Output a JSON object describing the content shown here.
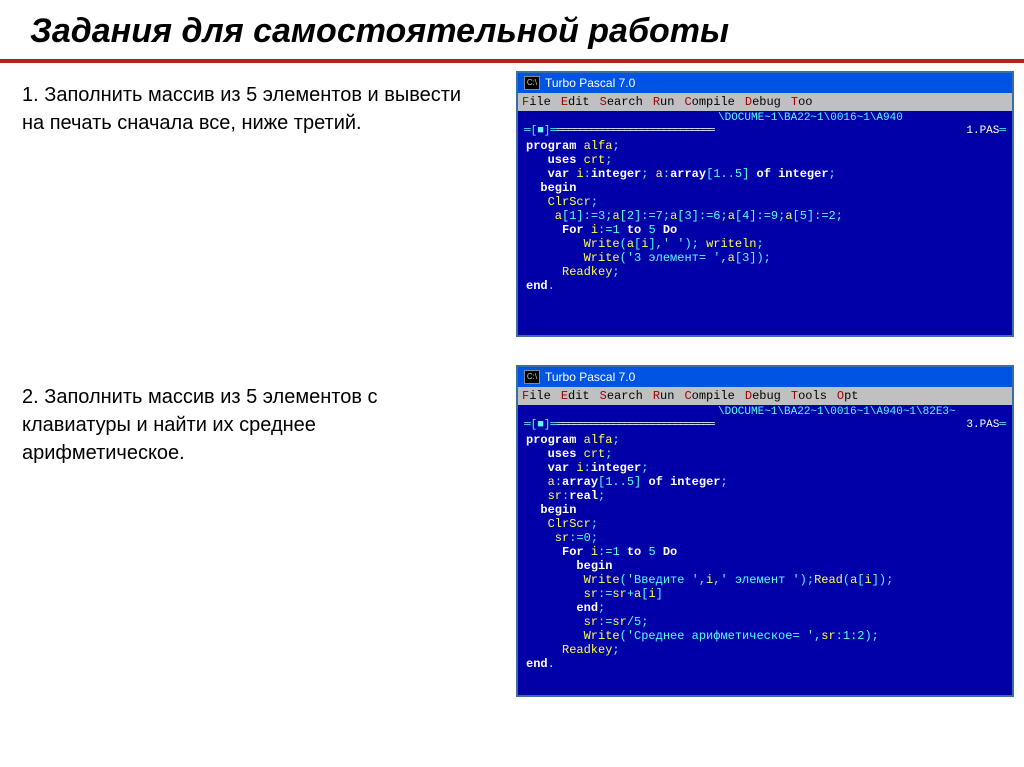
{
  "title": "Задания для самостоятельной работы",
  "task1": "1. Заполнить массив из 5 элементов и вывести на печать сначала все, ниже третий.",
  "task2": "2. Заполнить массив из 5 элементов с клавиатуры и найти их среднее арифметическое.",
  "windows": [
    {
      "titlebar_icon": "C:\\",
      "titlebar_text": "Turbo Pascal 7.0",
      "menu": [
        "File",
        "Edit",
        "Search",
        "Run",
        "Compile",
        "Debug",
        "Too"
      ],
      "path": "\\DOCUME~1\\BA22~1\\0016~1\\A940",
      "file_tab": "1.PAS",
      "code_lines": [
        [
          [
            "kw",
            "program"
          ],
          [
            "id",
            " alfa"
          ],
          [
            "sym",
            ";"
          ]
        ],
        [
          [
            "id",
            "   "
          ],
          [
            "kw",
            "uses"
          ],
          [
            "id",
            " crt"
          ],
          [
            "sym",
            ";"
          ]
        ],
        [
          [
            "id",
            "   "
          ],
          [
            "kw",
            "var"
          ],
          [
            "id",
            " i"
          ],
          [
            "sym",
            ":"
          ],
          [
            "kw",
            "integer"
          ],
          [
            "sym",
            "; "
          ],
          [
            "id",
            "a"
          ],
          [
            "sym",
            ":"
          ],
          [
            "kw",
            "array"
          ],
          [
            "sym",
            "["
          ],
          [
            "num",
            "1..5"
          ],
          [
            "sym",
            "] "
          ],
          [
            "kw",
            "of"
          ],
          [
            "id",
            " "
          ],
          [
            "kw",
            "integer"
          ],
          [
            "sym",
            ";"
          ]
        ],
        [
          [
            "id",
            "  "
          ],
          [
            "kw",
            "begin"
          ]
        ],
        [
          [
            "id",
            "   ClrScr"
          ],
          [
            "sym",
            ";"
          ]
        ],
        [
          [
            "id",
            "    a"
          ],
          [
            "sym",
            "["
          ],
          [
            "num",
            "1"
          ],
          [
            "sym",
            "]:="
          ],
          [
            "num",
            "3"
          ],
          [
            "sym",
            ";"
          ],
          [
            "id",
            "a"
          ],
          [
            "sym",
            "["
          ],
          [
            "num",
            "2"
          ],
          [
            "sym",
            "]:="
          ],
          [
            "num",
            "7"
          ],
          [
            "sym",
            ";"
          ],
          [
            "id",
            "a"
          ],
          [
            "sym",
            "["
          ],
          [
            "num",
            "3"
          ],
          [
            "sym",
            "]:="
          ],
          [
            "num",
            "6"
          ],
          [
            "sym",
            ";"
          ],
          [
            "id",
            "a"
          ],
          [
            "sym",
            "["
          ],
          [
            "num",
            "4"
          ],
          [
            "sym",
            "]:="
          ],
          [
            "num",
            "9"
          ],
          [
            "sym",
            ";"
          ],
          [
            "id",
            "a"
          ],
          [
            "sym",
            "["
          ],
          [
            "num",
            "5"
          ],
          [
            "sym",
            "]:="
          ],
          [
            "num",
            "2"
          ],
          [
            "sym",
            ";"
          ]
        ],
        [
          [
            "id",
            "     "
          ],
          [
            "kw",
            "For"
          ],
          [
            "id",
            " i"
          ],
          [
            "sym",
            ":="
          ],
          [
            "num",
            "1"
          ],
          [
            "id",
            " "
          ],
          [
            "kw",
            "to"
          ],
          [
            "id",
            " "
          ],
          [
            "num",
            "5"
          ],
          [
            "id",
            " "
          ],
          [
            "kw",
            "Do"
          ]
        ],
        [
          [
            "id",
            "        Write"
          ],
          [
            "sym",
            "("
          ],
          [
            "id",
            "a"
          ],
          [
            "sym",
            "["
          ],
          [
            "id",
            "i"
          ],
          [
            "sym",
            "],"
          ],
          [
            "str",
            "' '"
          ],
          [
            "sym",
            "); "
          ],
          [
            "id",
            "writeln"
          ],
          [
            "sym",
            ";"
          ]
        ],
        [
          [
            "id",
            "        Write"
          ],
          [
            "sym",
            "("
          ],
          [
            "str",
            "'3 элемент= '"
          ],
          [
            "sym",
            ","
          ],
          [
            "id",
            "a"
          ],
          [
            "sym",
            "["
          ],
          [
            "num",
            "3"
          ],
          [
            "sym",
            "]);"
          ]
        ],
        [
          [
            "id",
            "     Readkey"
          ],
          [
            "sym",
            ";"
          ]
        ],
        [
          [
            "kw",
            "end"
          ],
          [
            "sym",
            "."
          ]
        ]
      ]
    },
    {
      "titlebar_icon": "C:\\",
      "titlebar_text": "Turbo Pascal 7.0",
      "menu": [
        "File",
        "Edit",
        "Search",
        "Run",
        "Compile",
        "Debug",
        "Tools",
        "Opt"
      ],
      "path": "\\DOCUME~1\\BA22~1\\0016~1\\A940~1\\82E3~",
      "file_tab": "3.PAS",
      "code_lines": [
        [
          [
            "kw",
            "program"
          ],
          [
            "id",
            " alfa"
          ],
          [
            "sym",
            ";"
          ]
        ],
        [
          [
            "id",
            "   "
          ],
          [
            "kw",
            "uses"
          ],
          [
            "id",
            " crt"
          ],
          [
            "sym",
            ";"
          ]
        ],
        [
          [
            "id",
            "   "
          ],
          [
            "kw",
            "var"
          ],
          [
            "id",
            " i"
          ],
          [
            "sym",
            ":"
          ],
          [
            "kw",
            "integer"
          ],
          [
            "sym",
            ";"
          ]
        ],
        [
          [
            "id",
            "   a"
          ],
          [
            "sym",
            ":"
          ],
          [
            "kw",
            "array"
          ],
          [
            "sym",
            "["
          ],
          [
            "num",
            "1..5"
          ],
          [
            "sym",
            "] "
          ],
          [
            "kw",
            "of"
          ],
          [
            "id",
            " "
          ],
          [
            "kw",
            "integer"
          ],
          [
            "sym",
            ";"
          ]
        ],
        [
          [
            "id",
            "   sr"
          ],
          [
            "sym",
            ":"
          ],
          [
            "kw",
            "real"
          ],
          [
            "sym",
            ";"
          ]
        ],
        [
          [
            "id",
            "  "
          ],
          [
            "kw",
            "begin"
          ]
        ],
        [
          [
            "id",
            "   ClrScr"
          ],
          [
            "sym",
            ";"
          ]
        ],
        [
          [
            "id",
            "    sr"
          ],
          [
            "sym",
            ":="
          ],
          [
            "num",
            "0"
          ],
          [
            "sym",
            ";"
          ]
        ],
        [
          [
            "id",
            "     "
          ],
          [
            "kw",
            "For"
          ],
          [
            "id",
            " i"
          ],
          [
            "sym",
            ":="
          ],
          [
            "num",
            "1"
          ],
          [
            "id",
            " "
          ],
          [
            "kw",
            "to"
          ],
          [
            "id",
            " "
          ],
          [
            "num",
            "5"
          ],
          [
            "id",
            " "
          ],
          [
            "kw",
            "Do"
          ]
        ],
        [
          [
            "id",
            "       "
          ],
          [
            "kw",
            "begin"
          ]
        ],
        [
          [
            "id",
            "        Write"
          ],
          [
            "sym",
            "("
          ],
          [
            "str",
            "'Введите '"
          ],
          [
            "sym",
            ","
          ],
          [
            "id",
            "i"
          ],
          [
            "sym",
            ","
          ],
          [
            "str",
            "' элемент '"
          ],
          [
            "sym",
            ");"
          ],
          [
            "id",
            "Read"
          ],
          [
            "sym",
            "("
          ],
          [
            "id",
            "a"
          ],
          [
            "sym",
            "["
          ],
          [
            "id",
            "i"
          ],
          [
            "sym",
            "]);"
          ]
        ],
        [
          [
            "id",
            "        sr"
          ],
          [
            "sym",
            ":="
          ],
          [
            "id",
            "sr"
          ],
          [
            "sym",
            "+"
          ],
          [
            "id",
            "a"
          ],
          [
            "sym",
            "["
          ],
          [
            "id",
            "i"
          ],
          [
            "sym",
            "]"
          ]
        ],
        [
          [
            "id",
            "       "
          ],
          [
            "kw",
            "end"
          ],
          [
            "sym",
            ";"
          ]
        ],
        [
          [
            "id",
            "        sr"
          ],
          [
            "sym",
            ":="
          ],
          [
            "id",
            "sr"
          ],
          [
            "sym",
            "/"
          ],
          [
            "num",
            "5"
          ],
          [
            "sym",
            ";"
          ]
        ],
        [
          [
            "id",
            "        Write"
          ],
          [
            "sym",
            "("
          ],
          [
            "str",
            "'Среднее арифметическое= '"
          ],
          [
            "sym",
            ","
          ],
          [
            "id",
            "sr"
          ],
          [
            "sym",
            ":"
          ],
          [
            "num",
            "1"
          ],
          [
            "sym",
            ":"
          ],
          [
            "num",
            "2"
          ],
          [
            "sym",
            ");"
          ]
        ],
        [
          [
            "id",
            "     Readkey"
          ],
          [
            "sym",
            ";"
          ]
        ],
        [
          [
            "kw",
            "end"
          ],
          [
            "sym",
            "."
          ]
        ]
      ]
    }
  ]
}
